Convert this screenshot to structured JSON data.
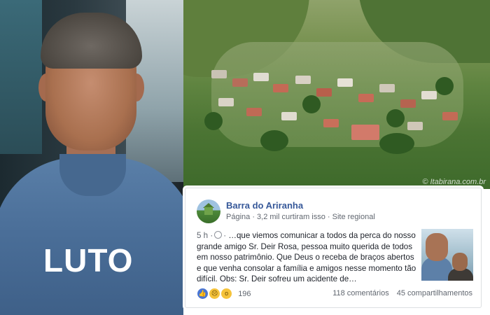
{
  "overlay_text": "LUTO",
  "landscape": {
    "watermark": "© Itabirana.com.br"
  },
  "post": {
    "page_name": "Barra do Ariranha",
    "meta": {
      "type": "Página",
      "likes": "3,2 mil curtiram isso",
      "category": "Site regional"
    },
    "time": "5 h",
    "text": "…que viemos comunicar a todos da perca do nosso grande amigo Sr. Deir Rosa, pessoa muito querida de todos em nosso patrimônio. Que Deus o receba de braços abertos e que venha consolar a família e amigos nesse momento tão difícil. Obs: Sr. Deir sofreu um acidente de…",
    "reaction_count": "196",
    "comments": "118 comentários",
    "shares": "45 compartilhamentos",
    "reactions": [
      "like-icon",
      "sad-icon",
      "wow-icon"
    ]
  },
  "colors": {
    "link": "#365899",
    "meta": "#616770",
    "text": "#1d2129"
  }
}
